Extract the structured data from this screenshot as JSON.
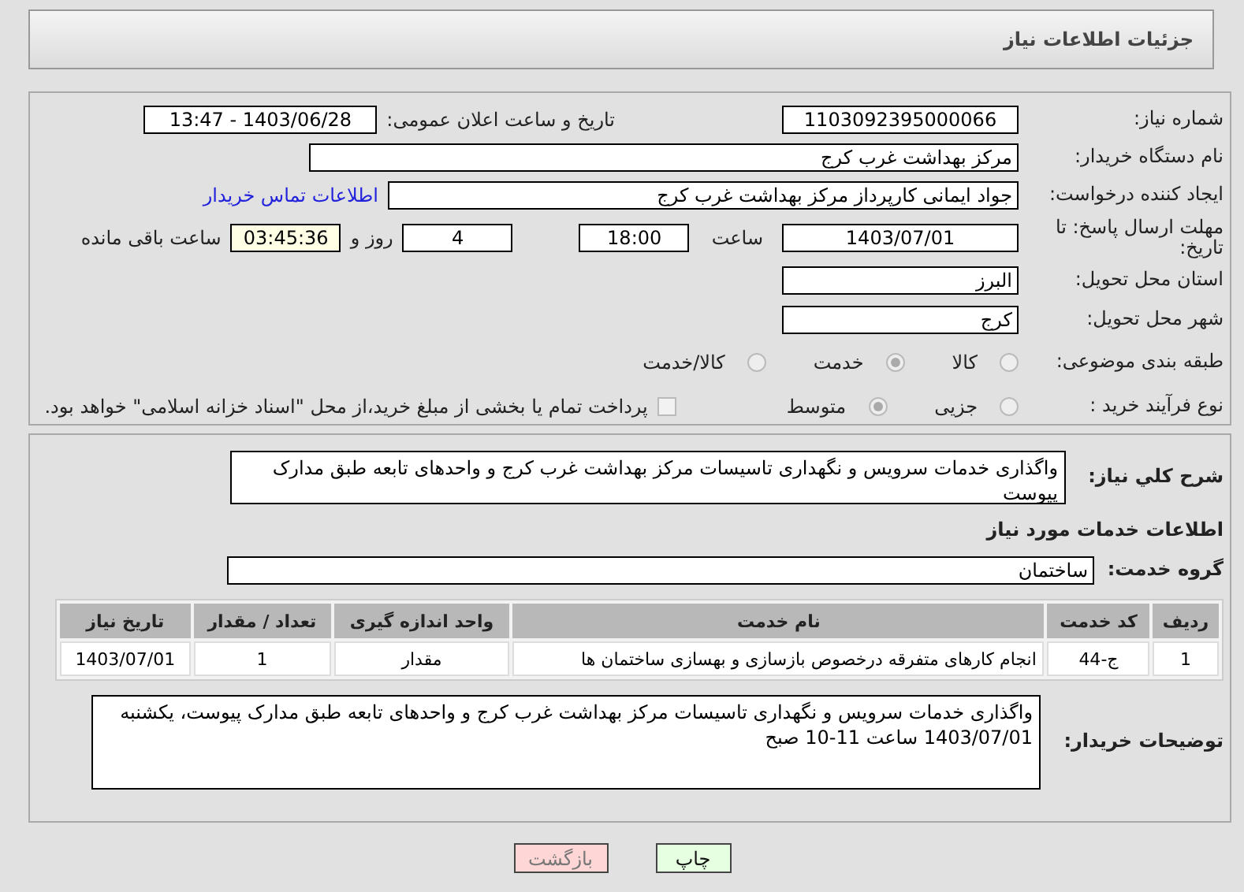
{
  "header": {
    "title": "جزئیات اطلاعات نیاز"
  },
  "details": {
    "need_number": {
      "label": "شماره نیاز:",
      "value": "1103092395000066"
    },
    "announce": {
      "label": "تاریخ و ساعت اعلان عمومی:",
      "value": "1403/06/28 - 13:47"
    },
    "buyer": {
      "label": "نام دستگاه خریدار:",
      "value": "مرکز بهداشت غرب کرج"
    },
    "creator": {
      "label": "ایجاد کننده درخواست:",
      "value": "جواد ایمانی کارپرداز مرکز بهداشت غرب کرج",
      "link": "اطلاعات تماس خریدار"
    },
    "deadline": {
      "label": "مهلت ارسال پاسخ: تا تاریخ:",
      "date": "1403/07/01",
      "time_label": "ساعت",
      "time": "18:00",
      "days": "4",
      "days_label": "روز و",
      "remaining": "03:45:36",
      "remaining_label": "ساعت باقی مانده"
    },
    "province": {
      "label": "استان محل تحویل:",
      "value": "البرز"
    },
    "city": {
      "label": "شهر محل تحویل:",
      "value": "کرج"
    },
    "category": {
      "label": "طبقه بندی موضوعی:",
      "options": [
        {
          "label": "کالا",
          "selected": false
        },
        {
          "label": "خدمت",
          "selected": true
        },
        {
          "label": "کالا/خدمت",
          "selected": false
        }
      ]
    },
    "process": {
      "label": "نوع فرآیند خرید :",
      "options": [
        {
          "label": "جزیی",
          "selected": false
        },
        {
          "label": "متوسط",
          "selected": true
        }
      ],
      "treasury": {
        "label": "پرداخت تمام یا بخشی از مبلغ خرید،از محل \"اسناد خزانه اسلامی\" خواهد بود.",
        "checked": false
      }
    }
  },
  "need": {
    "summary_label": "شرح کلي نياز:",
    "summary": "واگذاری خدمات سرویس و نگهداری تاسیسات مرکز بهداشت غرب کرج و واحدهای تابعه طبق مدارک پیوست",
    "services_title": "اطلاعات خدمات مورد نیاز",
    "group_label": "گروه خدمت:",
    "group": "ساختمان",
    "table": {
      "columns": [
        "ردیف",
        "کد خدمت",
        "نام خدمت",
        "واحد اندازه گیری",
        "تعداد / مقدار",
        "تاریخ نیاز"
      ],
      "rows": [
        [
          "1",
          "ج-44",
          "انجام کارهای متفرقه درخصوص بازسازی و بهسازی ساختمان ها",
          "مقدار",
          "1",
          "1403/07/01"
        ]
      ]
    },
    "notes_label": "توضیحات خریدار:",
    "notes": "واگذاری خدمات سرویس و نگهداری تاسیسات مرکز بهداشت غرب کرج و واحدهای تابعه طبق مدارک پیوست، یکشنبه 1403/07/01 ساعت 11-10 صبح"
  },
  "buttons": [
    {
      "label": "چاپ",
      "kind": "print"
    },
    {
      "label": "بازگشت",
      "kind": "back"
    }
  ]
}
